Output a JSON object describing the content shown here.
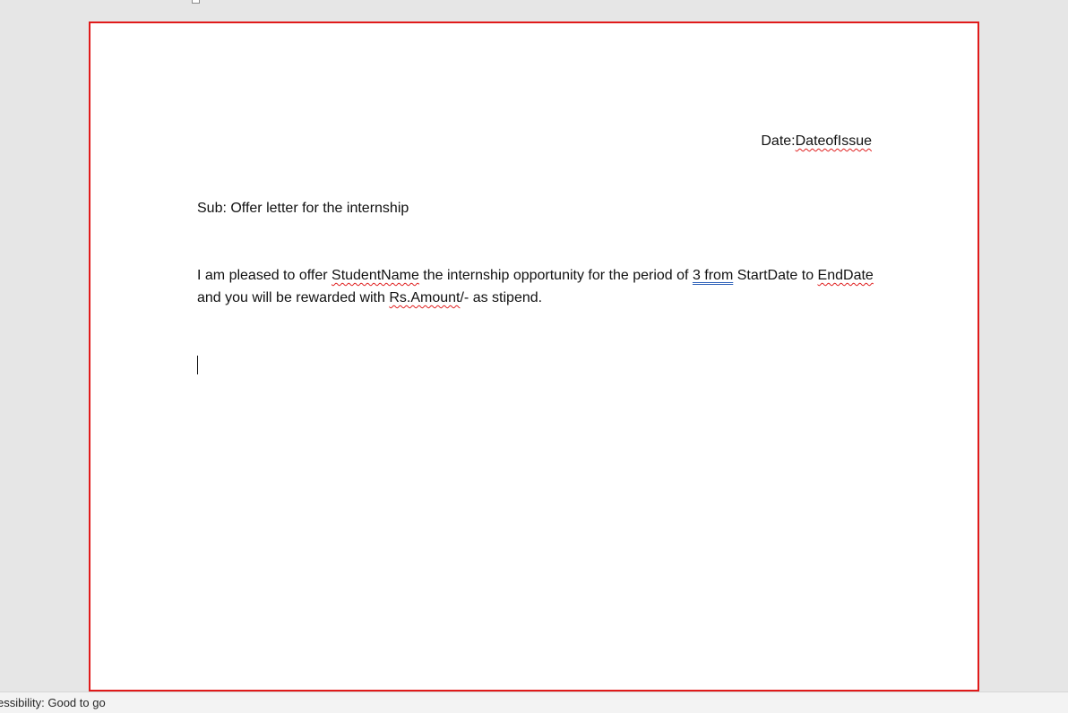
{
  "document": {
    "date_line": {
      "prefix": "Date:",
      "field": "DateofIssue"
    },
    "subject": "Sub: Offer letter for the internship",
    "body": {
      "t1": "I am pleased to offer ",
      "student_field": "StudentName",
      "t2": " the internship opportunity for the period of ",
      "period_value": "3  from",
      "t3": " StartDate to ",
      "end_date_field": "EndDate",
      "t4": " and you will be rewarded with ",
      "amount_field": "Rs.Amount",
      "t5": "/- as stipend."
    }
  },
  "status_bar": {
    "accessibility": "essibility: Good to go"
  },
  "colors": {
    "page_border": "#e01a1a",
    "spellcheck_underline": "#e02020",
    "grammar_underline": "#2b5fb8",
    "workspace": "#e6e6e6"
  }
}
